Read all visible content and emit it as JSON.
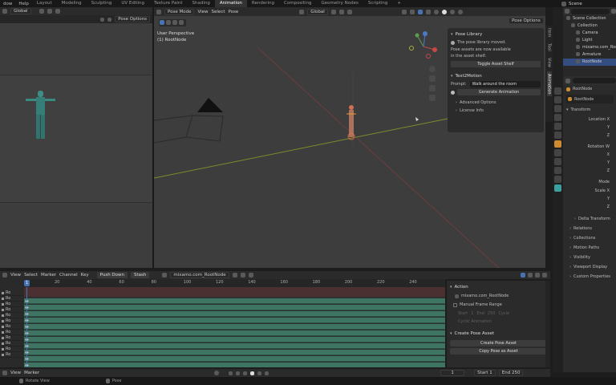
{
  "menubar": {
    "items": [
      "dow",
      "Help"
    ],
    "workspaces": [
      "Layout",
      "Modeling",
      "Sculpting",
      "UV Editing",
      "Texture Paint",
      "Shading",
      "Animation",
      "Rendering",
      "Compositing",
      "Geometry Nodes",
      "Scripting"
    ],
    "active_workspace": "Animation",
    "add_tab": "+",
    "scene_label": "Scene"
  },
  "left_view": {
    "transform_orientation": "Global",
    "pose_options": "Pose Options"
  },
  "viewport": {
    "mode": "Pose Mode",
    "menu": [
      "View",
      "Select",
      "Pose"
    ],
    "orientation": "Global",
    "pose_options": "Pose Options",
    "info_line1": "User Perspective",
    "info_line2": "(1) RootNode"
  },
  "pose_library": {
    "title": "Pose Library",
    "notice": "The pose library moved.",
    "desc1": "Pose assets are now available",
    "desc2": "in the asset shelf.",
    "toggle_button": "Toggle Asset Shelf"
  },
  "text2motion": {
    "title": "Text2Motion",
    "prompt_label": "Prompt:",
    "prompt_value": "Walk around the room",
    "generate_button": "Generate Animation",
    "advanced": "Advanced Options",
    "license": "License Info"
  },
  "n_tabs": [
    "Item",
    "Tool",
    "View",
    "Animation"
  ],
  "active_n_tab": "Animation",
  "timeline": {
    "menu": [
      "View",
      "Select",
      "Marker",
      "Channel",
      "Key"
    ],
    "push_down": "Push Down",
    "stash": "Stash",
    "action_name": "mixamo.com_RootNode",
    "current_frame_badge": "1",
    "ticks": [
      "20",
      "40",
      "60",
      "80",
      "100",
      "120",
      "140",
      "160",
      "180",
      "200",
      "220",
      "240"
    ],
    "channel_labels": [
      "Ro",
      "Ro",
      "Ro",
      "Ro",
      "Ro",
      "Ro",
      "Ro",
      "Ro",
      "Ro",
      "Ro",
      "Ro",
      "Ro"
    ]
  },
  "action_panel": {
    "title": "Action",
    "action_name": "mixamo.com_RootNode",
    "manual_range": "Manual Frame Range",
    "faded": [
      "Start",
      "End",
      "Cycle",
      "Cyclic Animation"
    ],
    "faded_values": [
      "1",
      "250",
      "Cycle"
    ],
    "create_pose_title": "Create Pose Asset",
    "create_pose_button": "Create Pose Asset",
    "copy_pose_button": "Copy Pose as Asset"
  },
  "playback": {
    "menu": [
      "View",
      "Marker"
    ],
    "frame": "1",
    "start_label": "Start",
    "start_value": "1",
    "end_label": "End",
    "end_value": "250"
  },
  "status_bar": {
    "left": "Rotate View",
    "mid": "Pose"
  },
  "outliner": {
    "search_placeholder": "",
    "items": [
      {
        "label": "Scene Collection",
        "indent": 0
      },
      {
        "label": "Collection",
        "indent": 1
      },
      {
        "label": "Camera",
        "indent": 2
      },
      {
        "label": "Light",
        "indent": 2
      },
      {
        "label": "mixamo.com_RootNode",
        "indent": 2
      },
      {
        "label": "Armature",
        "indent": 2
      },
      {
        "label": "RootNode",
        "indent": 2,
        "selected": true
      }
    ]
  },
  "properties": {
    "object_name": "RootNode",
    "object_name2": "RootNode",
    "transform_title": "Transform",
    "location_label": "Location X",
    "y": "Y",
    "z": "Z",
    "rotation_label": "Rotation W",
    "x": "X",
    "mode_label": "Mode",
    "scale_label": "Scale X",
    "sections": [
      "Delta Transform",
      "Relations",
      "Collections",
      "Motion Paths",
      "Visibility",
      "Viewport Display",
      "Custom Properties"
    ]
  },
  "colors": {
    "bg": "#1d1d1d",
    "panel": "#2b2b2b",
    "viewport": "#3d3d3d",
    "accent": "#4772b3",
    "track": "#3e7462",
    "channel_bg": "#343434",
    "active_tab": "#3b3b3b"
  }
}
